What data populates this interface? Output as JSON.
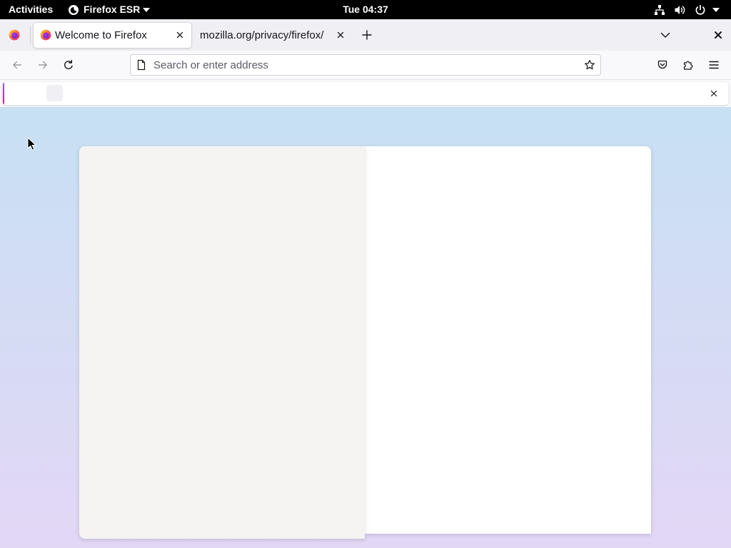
{
  "system_bar": {
    "activities_label": "Activities",
    "app_menu_label": "Firefox ESR",
    "clock": "Tue 04:37"
  },
  "browser": {
    "tabs": [
      {
        "title": "Welcome to Firefox",
        "selected": true
      },
      {
        "title": "mozilla.org/privacy/firefox/",
        "selected": false
      }
    ],
    "url_bar": {
      "value": "",
      "placeholder": "Search or enter address"
    },
    "nav": {
      "back_enabled": false,
      "forward_enabled": false
    }
  },
  "icons": {
    "system_bar": [
      "firefox-icon",
      "chevron-down-icon",
      "network-icon",
      "volume-icon",
      "power-icon",
      "chevron-down-icon"
    ],
    "tab_strip": [
      "firefox-view-icon",
      "firefox-favicon",
      "close-icon",
      "new-tab-icon",
      "list-all-tabs-icon",
      "close-window-icon"
    ],
    "nav_bar": [
      "back-icon",
      "forward-icon",
      "reload-icon",
      "page-icon",
      "bookmark-star-icon",
      "pocket-icon",
      "extensions-icon",
      "menu-icon"
    ],
    "notification": [
      "close-icon"
    ]
  },
  "colors": {
    "system_bar_bg": "#000000",
    "tab_strip_bg": "#f0f0f4",
    "selected_tab_bg": "#ffffff",
    "nav_bar_bg": "#f9f9fb",
    "notification_accent": "#e31587",
    "page_gradient_top": "#c7e0f3",
    "page_gradient_bottom": "#e3d7f6",
    "card_left_bg": "#f5f4f2",
    "card_right_bg": "#ffffff"
  }
}
